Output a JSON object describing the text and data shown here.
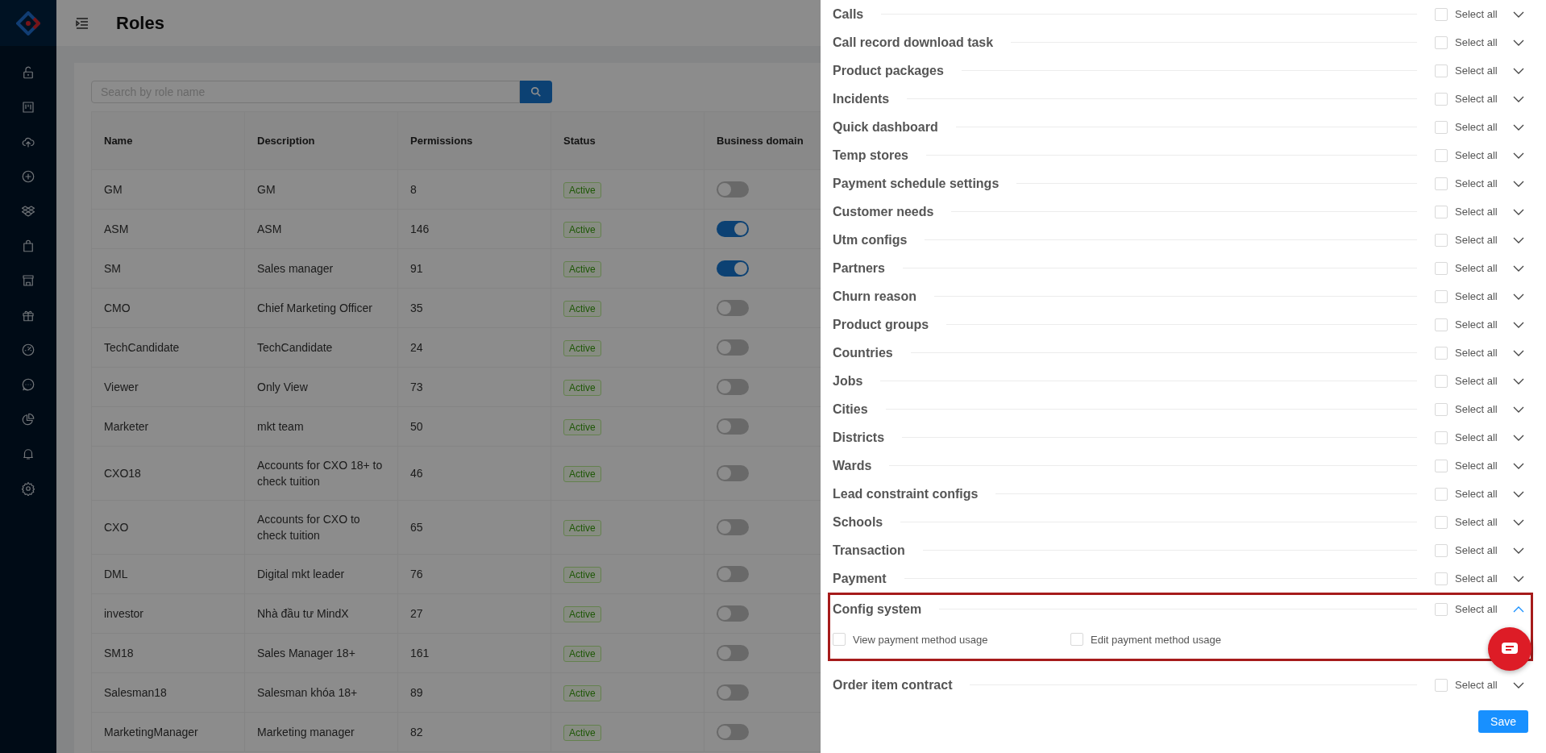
{
  "header": {
    "title": "Roles"
  },
  "search": {
    "placeholder": "Search by role name"
  },
  "table": {
    "columns": [
      "Name",
      "Description",
      "Permissions",
      "Status",
      "Business domain"
    ],
    "rows": [
      {
        "name": "GM",
        "description": "GM",
        "permissions": "8",
        "status": "Active",
        "domain_on": false
      },
      {
        "name": "ASM",
        "description": "ASM",
        "permissions": "146",
        "status": "Active",
        "domain_on": true
      },
      {
        "name": "SM",
        "description": "Sales manager",
        "permissions": "91",
        "status": "Active",
        "domain_on": true
      },
      {
        "name": "CMO",
        "description": "Chief Marketing Officer",
        "permissions": "35",
        "status": "Active",
        "domain_on": false
      },
      {
        "name": "TechCandidate",
        "description": "TechCandidate",
        "permissions": "24",
        "status": "Active",
        "domain_on": false
      },
      {
        "name": "Viewer",
        "description": "Only View",
        "permissions": "73",
        "status": "Active",
        "domain_on": false
      },
      {
        "name": "Marketer",
        "description": "mkt team",
        "permissions": "50",
        "status": "Active",
        "domain_on": false
      },
      {
        "name": "CXO18",
        "description": "Accounts for CXO 18+ to check tuition",
        "permissions": "46",
        "status": "Active",
        "domain_on": false
      },
      {
        "name": "CXO",
        "description": "Accounts for CXO to check tuition",
        "permissions": "65",
        "status": "Active",
        "domain_on": false
      },
      {
        "name": "DML",
        "description": "Digital mkt leader",
        "permissions": "76",
        "status": "Active",
        "domain_on": false
      },
      {
        "name": "investor",
        "description": "Nhà đầu tư MindX",
        "permissions": "27",
        "status": "Active",
        "domain_on": false
      },
      {
        "name": "SM18",
        "description": "Sales Manager 18+",
        "permissions": "161",
        "status": "Active",
        "domain_on": false
      },
      {
        "name": "Salesman18",
        "description": "Salesman khóa 18+",
        "permissions": "89",
        "status": "Active",
        "domain_on": false
      },
      {
        "name": "MarketingManager",
        "description": "Marketing manager",
        "permissions": "82",
        "status": "Active",
        "domain_on": false
      }
    ]
  },
  "drawer": {
    "groups": [
      {
        "title": "Calls",
        "select_label": "Select all",
        "checked": false,
        "expanded": false,
        "highlighted": false
      },
      {
        "title": "Call record download task",
        "select_label": "Select all",
        "checked": false,
        "expanded": false,
        "highlighted": false
      },
      {
        "title": "Product packages",
        "select_label": "Select all",
        "checked": false,
        "expanded": false,
        "highlighted": false
      },
      {
        "title": "Incidents",
        "select_label": "Select all",
        "checked": false,
        "expanded": false,
        "highlighted": false
      },
      {
        "title": "Quick dashboard",
        "select_label": "Select all",
        "checked": false,
        "expanded": false,
        "highlighted": false
      },
      {
        "title": "Temp stores",
        "select_label": "Select all",
        "checked": false,
        "expanded": false,
        "highlighted": false
      },
      {
        "title": "Payment schedule settings",
        "select_label": "Select all",
        "checked": false,
        "expanded": false,
        "highlighted": false
      },
      {
        "title": "Customer needs",
        "select_label": "Select all",
        "checked": false,
        "expanded": false,
        "highlighted": false
      },
      {
        "title": "Utm configs",
        "select_label": "Select all",
        "checked": false,
        "expanded": false,
        "highlighted": false
      },
      {
        "title": "Partners",
        "select_label": "Select all",
        "checked": false,
        "expanded": false,
        "highlighted": false
      },
      {
        "title": "Churn reason",
        "select_label": "Select all",
        "checked": false,
        "expanded": false,
        "highlighted": false
      },
      {
        "title": "Product groups",
        "select_label": "Select all",
        "checked": false,
        "expanded": false,
        "highlighted": false
      },
      {
        "title": "Countries",
        "select_label": "Select all",
        "checked": false,
        "expanded": false,
        "highlighted": false
      },
      {
        "title": "Jobs",
        "select_label": "Select all",
        "checked": false,
        "expanded": false,
        "highlighted": false
      },
      {
        "title": "Cities",
        "select_label": "Select all",
        "checked": false,
        "expanded": false,
        "highlighted": false
      },
      {
        "title": "Districts",
        "select_label": "Select all",
        "checked": false,
        "expanded": false,
        "highlighted": false
      },
      {
        "title": "Wards",
        "select_label": "Select all",
        "checked": false,
        "expanded": false,
        "highlighted": false
      },
      {
        "title": "Lead constraint configs",
        "select_label": "Select all",
        "checked": false,
        "expanded": false,
        "highlighted": false
      },
      {
        "title": "Schools",
        "select_label": "Select all",
        "checked": false,
        "expanded": false,
        "highlighted": false
      },
      {
        "title": "Transaction",
        "select_label": "Select all",
        "checked": false,
        "expanded": false,
        "highlighted": false
      },
      {
        "title": "Payment",
        "select_label": "Select all",
        "checked": false,
        "expanded": false,
        "highlighted": false
      },
      {
        "title": "Config system",
        "select_label": "Select all",
        "checked": false,
        "expanded": true,
        "highlighted": true,
        "permissions": [
          {
            "label": "View payment method usage",
            "checked": false
          },
          {
            "label": "Edit payment method usage",
            "checked": false
          }
        ]
      },
      {
        "title": "Order item contract",
        "select_label": "Select all",
        "checked": false,
        "expanded": false,
        "highlighted": false
      }
    ],
    "save_button": "Save"
  }
}
